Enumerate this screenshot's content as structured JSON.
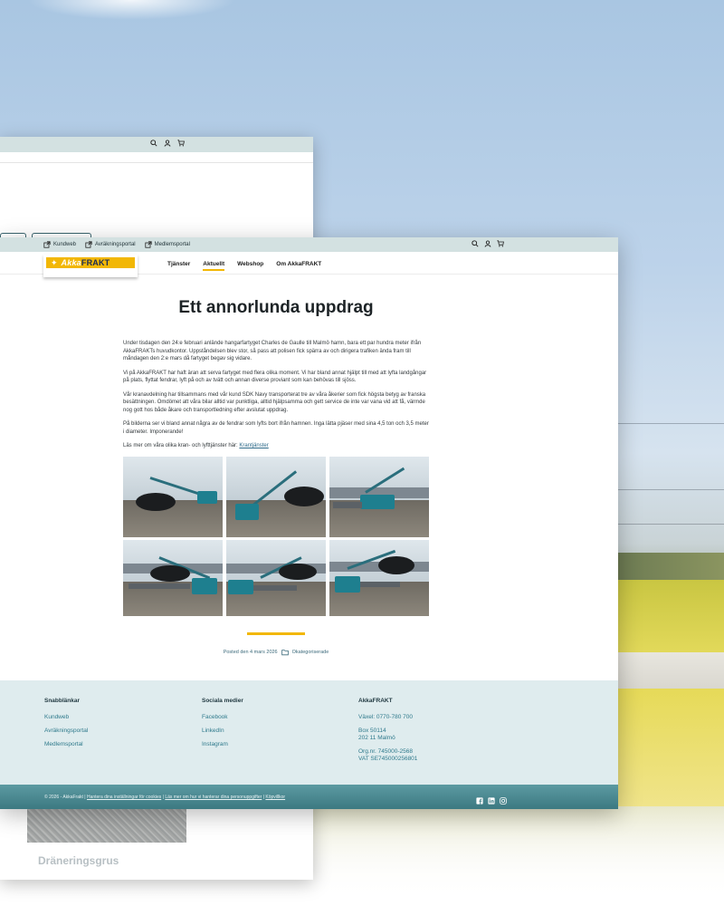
{
  "back_window": {
    "partial_title": "Dräneringsgrus"
  },
  "topbar": {
    "links": [
      {
        "label": "Kundweb"
      },
      {
        "label": "Avräkningsportal"
      },
      {
        "label": "Medlemsportal"
      }
    ],
    "icons": [
      "search-icon",
      "user-icon",
      "cart-icon"
    ]
  },
  "logo": {
    "part1": "Akka",
    "part2": "FRAKT"
  },
  "nav": {
    "items": [
      {
        "label": "Tjänster",
        "active": false
      },
      {
        "label": "Aktuellt",
        "active": true
      },
      {
        "label": "Webshop",
        "active": false
      },
      {
        "label": "Om AkkaFRAKT",
        "active": false
      }
    ],
    "active_underline_color": "#f2b705"
  },
  "article": {
    "title": "Ett annorlunda uppdrag",
    "paragraphs": [
      "Under tisdagen den 24:e februari anlände hangarfartyget Charles de Gaulle till Malmö hamn, bara ett par hundra meter ifrån AkkaFRAKTs huvudkontor. Uppståndelsen blev stor, så pass att polisen fick spärra av och dirigera trafiken ända fram till måndagen den 2:e mars då fartyget begav sig vidare.",
      "Vi på AkkaFRAKT har haft äran att serva fartyget med flera olika moment. Vi har bland annat hjälpt till med att lyfta landgångar på plats, flyttat fendrar, lyft på och av tvätt och annan diverse proviant som kan behövas till sjöss.",
      "Vår kranavdelning har tillsammans med vår kund SDK Navy transporterat tre av våra åkerier som fick högsta betyg av franska besättningen. Omdömet att våra bilar alltid var punktliga, alltid hjälpsamma och gett service de inte var vana vid att få, värmde nog gott hos både åkare och transportledning efter avslutat uppdrag.",
      "På bilderna ser vi bland annat några av de fendrar som lyfts bort ifrån hamnen. Inga lätta pjäser med sina 4,5 ton och 3,5 meter i diameter. Imponerande!"
    ],
    "link_prefix": "Läs mer om våra olika kran- och lyfttjänster här: ",
    "link_text": "Krantjänster",
    "posted": "Posted den 4 mars 2026",
    "category": "Okategoriserade"
  },
  "footer": {
    "col1": {
      "heading": "Snabblänkar",
      "links": [
        "Kundweb",
        "Avräkningsportal",
        "Medlemsportal"
      ]
    },
    "col2": {
      "heading": "Sociala medier",
      "links": [
        "Facebook",
        "LinkedIn",
        "Instagram"
      ]
    },
    "col3": {
      "heading": "AkkaFRAKT",
      "phone": "Växel: 0770-780 700",
      "box": "Box 50114",
      "city": "202 11 Malmö",
      "org": "Org.nr. 745000-2568",
      "vat": "VAT SE745000256801"
    }
  },
  "bottombar": {
    "copyright": "© 2026 - AkkaFrakt | ",
    "links": [
      "Hantera dina inställningar för cookies",
      "Läs mer om hur vi hanterar dina personuppgifter",
      "Köpvillkor"
    ],
    "social_icons": [
      "facebook-icon",
      "linkedin-icon",
      "instagram-icon"
    ]
  },
  "colors": {
    "accent": "#f2b705",
    "topbar_bg": "#d3e1e1",
    "footer_bg": "#dfecee",
    "bottombar_bg": "#4a878f",
    "link": "#2f7a8c"
  }
}
